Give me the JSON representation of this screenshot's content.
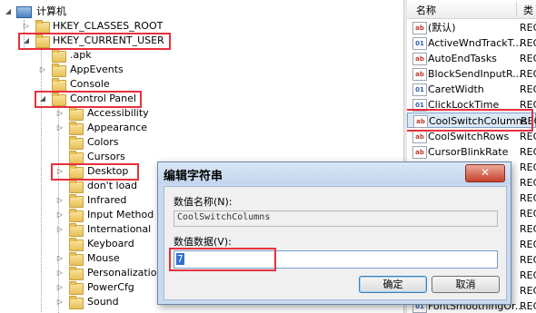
{
  "tree": {
    "root": "计算机",
    "items": [
      {
        "label": "HKEY_CLASSES_ROOT"
      },
      {
        "label": "HKEY_CURRENT_USER"
      },
      {
        "label": ".apk"
      },
      {
        "label": "AppEvents"
      },
      {
        "label": "Console"
      },
      {
        "label": "Control Panel"
      },
      {
        "label": "Accessibility"
      },
      {
        "label": "Appearance"
      },
      {
        "label": "Colors"
      },
      {
        "label": "Cursors"
      },
      {
        "label": "Desktop"
      },
      {
        "label": "don't load"
      },
      {
        "label": "Infrared"
      },
      {
        "label": "Input Method"
      },
      {
        "label": "International"
      },
      {
        "label": "Keyboard"
      },
      {
        "label": "Mouse"
      },
      {
        "label": "Personalization"
      },
      {
        "label": "PowerCfg"
      },
      {
        "label": "Sound"
      }
    ]
  },
  "values": {
    "header_name": "名称",
    "header_type": "类",
    "rows": [
      {
        "name": "(默认)",
        "type": "REG",
        "icon": "string-value-icon"
      },
      {
        "name": "ActiveWndTrackT...",
        "type": "REG",
        "icon": "binary-value-icon"
      },
      {
        "name": "AutoEndTasks",
        "type": "REG",
        "icon": "string-value-icon"
      },
      {
        "name": "BlockSendInputR...",
        "type": "REG",
        "icon": "string-value-icon"
      },
      {
        "name": "CaretWidth",
        "type": "REG",
        "icon": "binary-value-icon"
      },
      {
        "name": "ClickLockTime",
        "type": "REG",
        "icon": "binary-value-icon"
      },
      {
        "name": "CoolSwitchColumns",
        "type": "REG",
        "icon": "string-value-icon"
      },
      {
        "name": "CoolSwitchRows",
        "type": "REG",
        "icon": "string-value-icon"
      },
      {
        "name": "CursorBlinkRate",
        "type": "REG",
        "icon": "string-value-icon"
      },
      {
        "name": "REC",
        "type": "",
        "icon": ""
      },
      {
        "name": "REC",
        "type": "",
        "icon": ""
      },
      {
        "name": "REC",
        "type": "",
        "icon": ""
      },
      {
        "name": "REC",
        "type": "",
        "icon": ""
      },
      {
        "name": "REC",
        "type": "",
        "icon": ""
      },
      {
        "name": "REC",
        "type": "",
        "icon": ""
      },
      {
        "name": "REC",
        "type": "",
        "icon": ""
      },
      {
        "name": "REC",
        "type": "",
        "icon": ""
      },
      {
        "name": "REC",
        "type": "",
        "icon": ""
      },
      {
        "name": "FontSmoothingOr...",
        "type": "REC",
        "icon": "binary-value-icon"
      }
    ]
  },
  "dialog": {
    "title": "编辑字符串",
    "close_label": "✕",
    "name_label": "数值名称(N):",
    "name_value": "CoolSwitchColumns",
    "data_label": "数值数据(V):",
    "data_value": "7",
    "ok_label": "确定",
    "cancel_label": "取消"
  },
  "colors": {
    "highlight_box": "#e8303c",
    "dialog_frame": "#c9daf0",
    "selection": "#3070d0"
  }
}
